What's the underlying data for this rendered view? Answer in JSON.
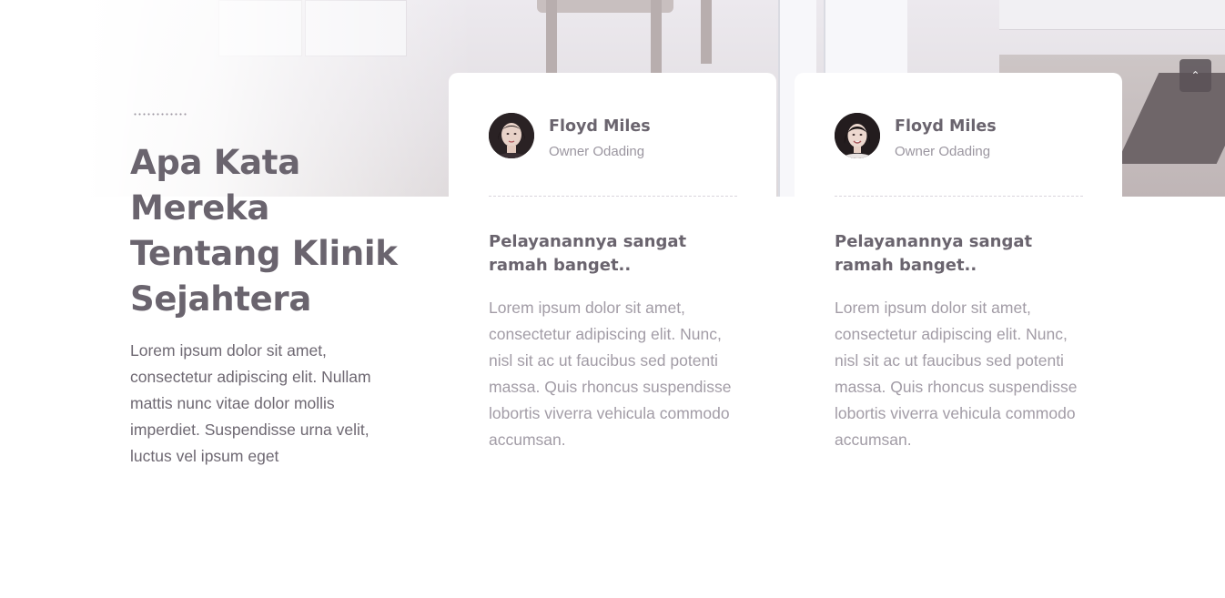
{
  "section": {
    "title": "Apa Kata Mereka Tentang Klinik Sejahtera",
    "description": "Lorem ipsum dolor sit amet, consectetur adipiscing elit. Nullam mattis nunc vitae dolor mollis imperdiet. Suspendisse urna velit, luctus vel ipsum eget"
  },
  "testimonials": [
    {
      "name": "Floyd Miles",
      "role": "Owner Odading",
      "quote_title": "Pelayanannya sangat ramah banget..",
      "quote_body": "Lorem ipsum dolor sit amet, consectetur adipiscing elit. Nunc, nisl sit ac ut faucibus sed potenti massa. Quis rhoncus suspendisse lobortis viverra vehicula commodo accumsan."
    },
    {
      "name": "Floyd Miles",
      "role": "Owner Odading",
      "quote_title": "Pelayanannya sangat ramah banget..",
      "quote_body": "Lorem ipsum dolor sit amet, consectetur adipiscing elit. Nunc, nisl sit ac ut faucibus sed potenti massa. Quis rhoncus suspendisse lobortis viverra vehicula commodo accumsan."
    }
  ],
  "back_to_top": {
    "icon": "chevron-up-icon",
    "glyph": "⌃"
  },
  "colors": {
    "heading": "#6a646e",
    "muted": "#a29ca6",
    "button": "#5a5257"
  }
}
